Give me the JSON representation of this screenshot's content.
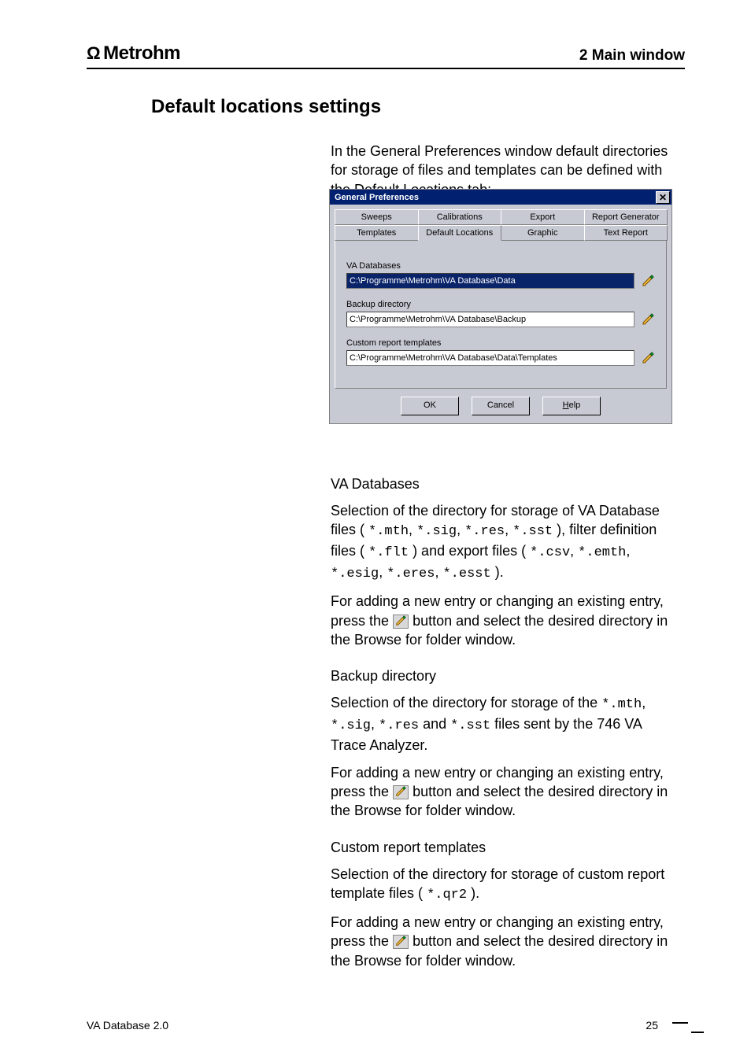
{
  "header": {
    "brand": "Metrohm",
    "breadcrumb_num": "2",
    "breadcrumb_sec": "Main window"
  },
  "section_title": "Default locations settings",
  "intro": {
    "p1_a": "In the ",
    "p1_b": "General Preferences",
    "p1_c": " window default directories for storage of files and templates can be defined with the ",
    "p1_d": "Default Locations",
    "p1_e": " tab:"
  },
  "dialog": {
    "title": "General Preferences",
    "close": "✕",
    "tabs_row1": [
      "Sweeps",
      "Calibrations",
      "Export",
      "Report Generator"
    ],
    "tabs_row2": [
      "Templates",
      "Default Locations",
      "Graphic",
      "Text Report"
    ],
    "active_tab_index_row2": 1,
    "fields": {
      "va_db_label": "VA Databases",
      "va_db_value": "C:\\Programme\\Metrohm\\VA Database\\Data",
      "backup_label": "Backup directory",
      "backup_value": "C:\\Programme\\Metrohm\\VA Database\\Backup",
      "custom_label": "Custom report templates",
      "custom_value": "C:\\Programme\\Metrohm\\VA Database\\Data\\Templates"
    },
    "buttons": {
      "ok": "OK",
      "cancel": "Cancel",
      "help_prefix": "H",
      "help_rest": "elp"
    }
  },
  "desc": {
    "va_db": {
      "title": "VA Databases",
      "body_a": "Selection of the directory for storage of VA Database files (",
      "ext_list_1": "*.mth",
      "sep": ", ",
      "ext_list_2": "*.sig",
      "ext_list_3": "*.res",
      "ext_list_4": "*.sst",
      "body_b": "), filter definition files (",
      "ext_flt": "*.flt",
      "body_c": ") and export files (",
      "ext_e1": "*.csv",
      "ext_e2": "*.emth",
      "ext_e3": "*.esig",
      "ext_e4": "*.eres",
      "ext_e5": "*.esst",
      "body_d": ").",
      "p2_a": "For adding a new entry or changing an existing entry, press the ",
      "p2_b": " button and select the desired directory in the ",
      "p2_c": "Browse for folder",
      "p2_d": " window."
    },
    "backup": {
      "title": "Backup directory",
      "body_a": "Selection of the directory for storage of the ",
      "b1": "*.mth",
      "b2": "*.sig",
      "b3": "*.res",
      "body_b": " and ",
      "b4": "*.sst",
      "body_c": " files sent by the 746 VA Trace Analyzer.",
      "p2_a": "For adding a new entry or changing an existing entry, press the ",
      "p2_b": " button and select the desired directory in the ",
      "p2_c": "Browse for folder",
      "p2_d": " window."
    },
    "custom": {
      "title": "Custom report templates",
      "body_a": "Selection of the directory for storage of custom report template files (",
      "ext": "*.qr2",
      "body_b": ").",
      "p2_a": "For adding a new entry or changing an existing entry, press the ",
      "p2_b": " button and select the desired directory in the ",
      "p2_c": "Browse for folder",
      "p2_d": " window."
    }
  },
  "footer": {
    "product": "VA Database 2.0",
    "page": "25"
  }
}
